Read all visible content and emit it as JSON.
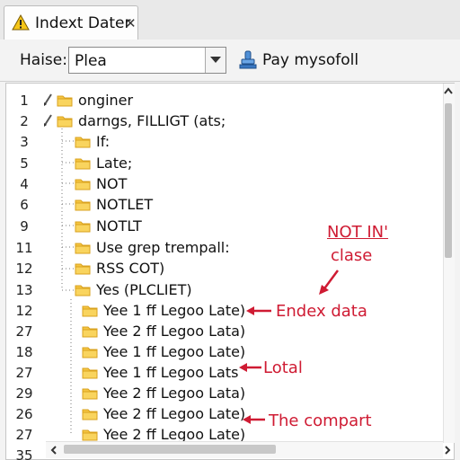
{
  "tab": {
    "title": "Indext Dater",
    "warning_icon": "warning-icon",
    "close_label": "✕"
  },
  "toolbar": {
    "field_label": "Haise:",
    "combo_value": "Plea",
    "action_label": "Pay mysofoll"
  },
  "tree": {
    "rows": [
      {
        "line": "1",
        "label": "onginer"
      },
      {
        "line": "2",
        "label": "darngs, FILLIGT (ats;"
      },
      {
        "line": "3",
        "label": "If:"
      },
      {
        "line": "5",
        "label": "Late;"
      },
      {
        "line": "4",
        "label": "NOT"
      },
      {
        "line": "6",
        "label": "NOTLET"
      },
      {
        "line": "9",
        "label": "NOTLT"
      },
      {
        "line": "11",
        "label": "Use grep trempall:"
      },
      {
        "line": "12",
        "label": "RSS COT)"
      },
      {
        "line": "13",
        "label": "Yes (PLCLIET)"
      },
      {
        "line": "12",
        "label": "Yee 1 ff Legoo Late)"
      },
      {
        "line": "27",
        "label": "Yee 2 ff Legoo Lata)"
      },
      {
        "line": "18",
        "label": "Yee 1 ff Legoo Late)"
      },
      {
        "line": "27",
        "label": "Yee 1 ff Legoo Lats"
      },
      {
        "line": "29",
        "label": "Yee 2 ff Legoo Lata)"
      },
      {
        "line": "26",
        "label": "Yee 2 ff Legoo Late)"
      },
      {
        "line": "27",
        "label": "Yee 2 ff Legoo Late)"
      },
      {
        "line": "35",
        "label": ""
      }
    ]
  },
  "annotations": {
    "not_in": "NOT IN'",
    "clase": "clase",
    "endex": "Endex data",
    "lotal": "Lotal",
    "compart": "The compart"
  },
  "colors": {
    "accent_red": "#cf1b33",
    "folder": "#f5c542",
    "folder_dark": "#d9a21e"
  }
}
